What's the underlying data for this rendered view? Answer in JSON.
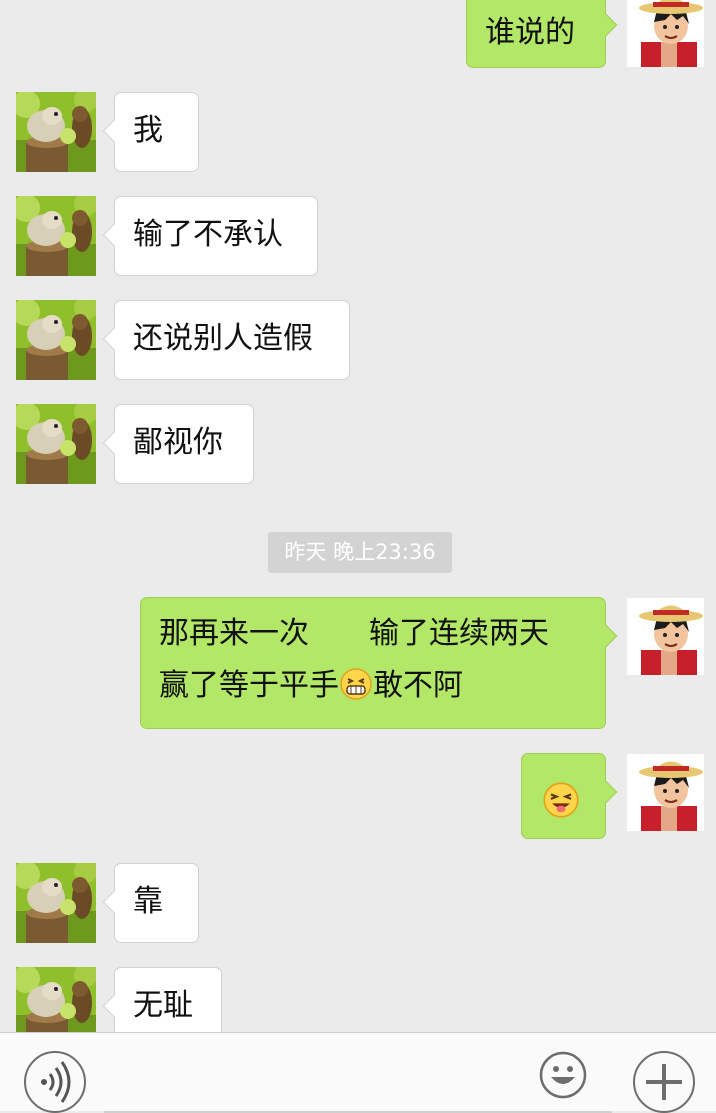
{
  "messages": [
    {
      "side": "right",
      "text": "谁说的"
    },
    {
      "side": "left",
      "text": "我"
    },
    {
      "side": "left",
      "text": "输了不承认"
    },
    {
      "side": "left",
      "text": "还说别人造假"
    },
    {
      "side": "left",
      "text": "鄙视你"
    },
    {
      "side": "right",
      "line1": "那再来一次　　输了连续两天",
      "line2_before": "赢了等于平手",
      "line2_emoji": "grin-emoji",
      "line2_after": "敢不阿"
    },
    {
      "side": "right",
      "emoji": "wink-tongue-emoji"
    },
    {
      "side": "left",
      "text": "靠"
    },
    {
      "side": "left",
      "text": "无耻"
    }
  ],
  "timestamp": "昨天 晚上23:36",
  "input_bar": {
    "voice_icon": "voice-icon",
    "emoji_icon": "smiley-icon",
    "plus_icon": "plus-icon"
  },
  "colors": {
    "background": "#ebebeb",
    "sent_bubble": "#b3e767",
    "received_bubble": "#ffffff",
    "timestamp_bg": "#d3d3d3"
  },
  "avatars": {
    "left": "hamster-avatar",
    "right": "straw-hat-avatar"
  }
}
